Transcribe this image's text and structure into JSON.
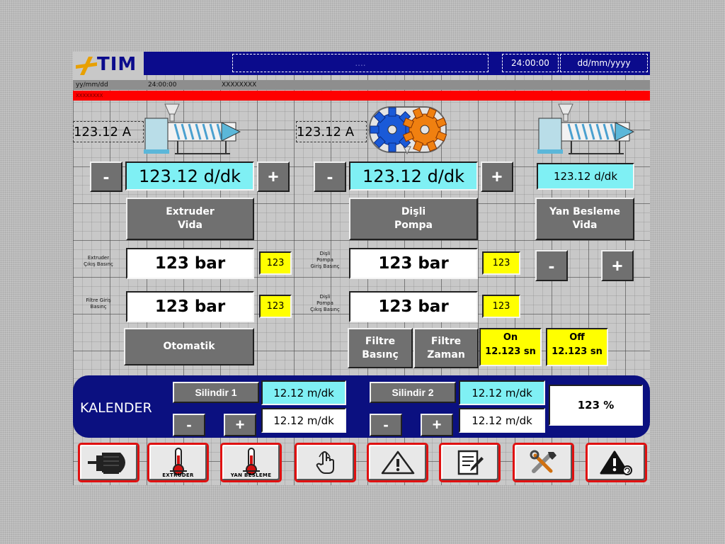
{
  "header": {
    "logo": "TIM",
    "center_box": "....",
    "time": "24:00:00",
    "date": "dd/mm/yyyy"
  },
  "info_bar": {
    "date": "yy/mm/dd",
    "time": "24:00:00",
    "message": "XXXXXXXX"
  },
  "alarm_bar": {
    "text": "XXXXXXXX"
  },
  "extruder": {
    "current": "123.12 A",
    "speed": "123.12 d/dk",
    "minus": "-",
    "plus": "+",
    "button": "Extruder\nVida",
    "pressure_out_label": "Extruder\nÇıkış Basınç",
    "pressure_out": "123 bar",
    "pressure_out_small": "123",
    "filter_in_label": "Filtre Giriş\nBasınç",
    "filter_in": "123 bar",
    "filter_in_small": "123",
    "auto_button": "Otomatik"
  },
  "gear_pump": {
    "current": "123.12 A",
    "speed": "123.12 d/dk",
    "minus": "-",
    "plus": "+",
    "button": "Dişli\nPompa",
    "in_label": "Dişli\nPompa\nGiriş Basınç",
    "in_pressure": "123 bar",
    "in_small": "123",
    "out_label": "Dişli\nPompa\nÇıkış Basınç",
    "out_pressure": "123 bar",
    "out_small": "123",
    "filter_pressure_btn": "Filtre\nBasınç",
    "filter_time_btn": "Filtre\nZaman",
    "on_label": "On",
    "on_value": "12.123 sn",
    "off_label": "Off",
    "off_value": "12.123 sn"
  },
  "side_feed": {
    "speed": "123.12 d/dk",
    "button": "Yan Besleme\nVida",
    "minus": "-",
    "plus": "+"
  },
  "kalender": {
    "title": "KALENDER",
    "roll1_label": "Silindir 1",
    "roll1_set": "12.12 m/dk",
    "roll1_act": "12.12 m/dk",
    "roll2_label": "Silindir 2",
    "roll2_set": "12.12 m/dk",
    "roll2_act": "12.12 m/dk",
    "minus": "-",
    "plus": "+",
    "percent": "123 %"
  },
  "nav": [
    {
      "icon": "motor-icon",
      "label": ""
    },
    {
      "icon": "thermometer-icon",
      "label": "EXTRUDER"
    },
    {
      "icon": "thermometer-icon",
      "label": "YAN BESLEME"
    },
    {
      "icon": "hand-pointer-icon",
      "label": ""
    },
    {
      "icon": "warning-icon",
      "label": ""
    },
    {
      "icon": "notepad-icon",
      "label": ""
    },
    {
      "icon": "tools-icon",
      "label": ""
    },
    {
      "icon": "alarm-reset-icon",
      "label": ""
    }
  ],
  "colors": {
    "header_blue": "#0b0b8c",
    "value_cyan": "#7ff0f4",
    "value_yellow": "#ffff00",
    "alarm_red": "#ff0000",
    "button_gray": "#707070"
  }
}
